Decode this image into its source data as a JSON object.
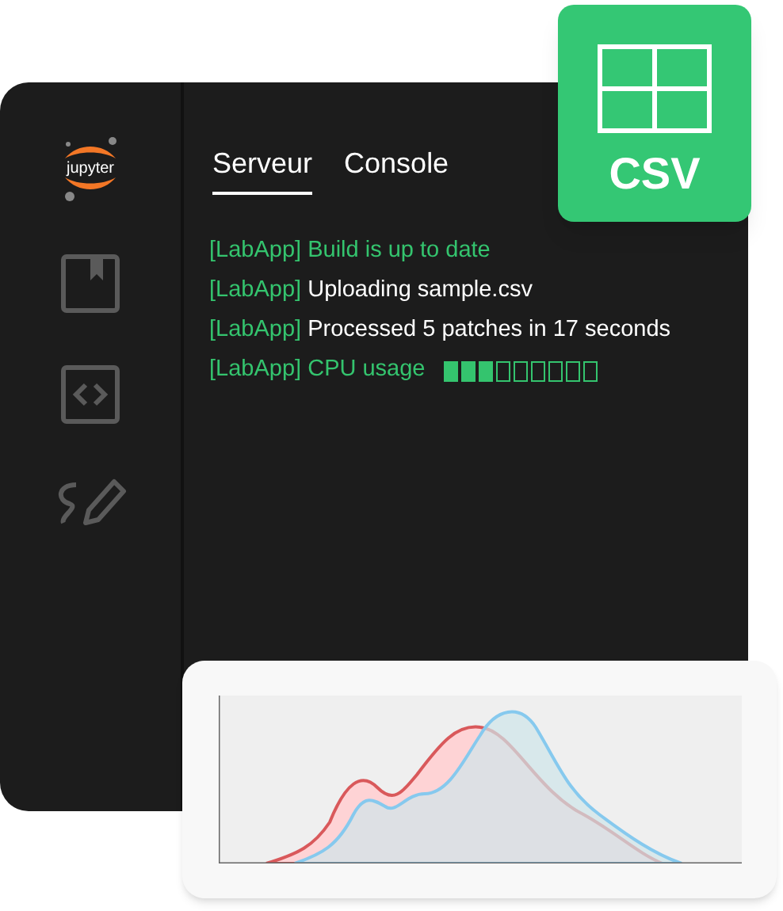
{
  "sidebar": {
    "logo_text": "jupyter",
    "items": [
      {
        "kind": "notebook"
      },
      {
        "kind": "code"
      },
      {
        "kind": "draw"
      }
    ]
  },
  "tabs": [
    {
      "label": "Serveur",
      "selected": true
    },
    {
      "label": "Console",
      "selected": false
    }
  ],
  "log": [
    {
      "prefix": "[LabApp]",
      "message": "Build is up to date",
      "kind": "success"
    },
    {
      "prefix": "[LabApp]",
      "message": "Uploading sample.csv",
      "kind": "info"
    },
    {
      "prefix": "[LabApp]",
      "message": "Processed 5 patches in 17 seconds",
      "kind": "info"
    },
    {
      "prefix": "[LabApp]",
      "message": "CPU usage",
      "kind": "meter",
      "level": 0.33
    }
  ],
  "file_badge": {
    "label": "CSV"
  }
}
